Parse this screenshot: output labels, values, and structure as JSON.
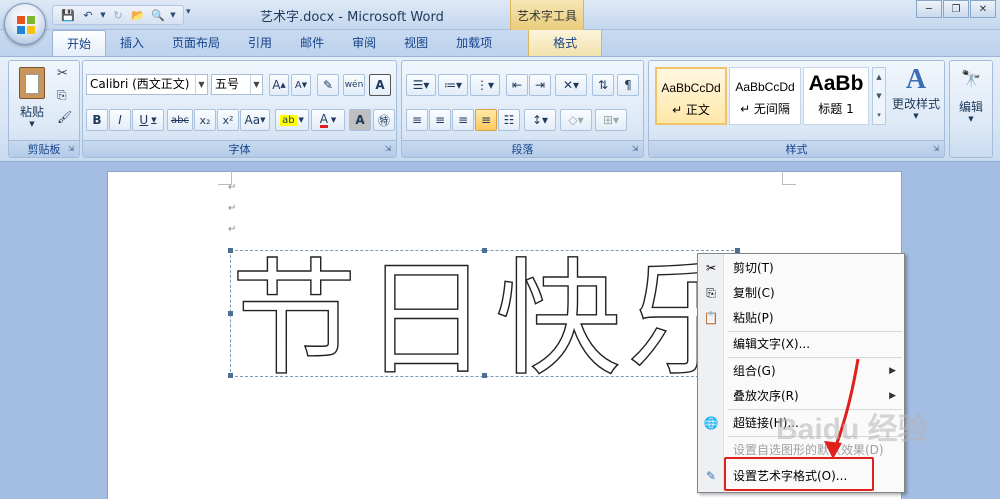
{
  "window": {
    "title": "艺术字.docx - Microsoft Word",
    "context_tool_title": "艺术字工具"
  },
  "tabs": [
    {
      "label": "开始",
      "active": true
    },
    {
      "label": "插入"
    },
    {
      "label": "页面布局"
    },
    {
      "label": "引用"
    },
    {
      "label": "邮件"
    },
    {
      "label": "审阅"
    },
    {
      "label": "视图"
    },
    {
      "label": "加载项"
    },
    {
      "label": "格式",
      "context": true
    }
  ],
  "ribbon": {
    "clipboard": {
      "label": "剪贴板",
      "paste_label": "粘贴"
    },
    "font": {
      "label": "字体",
      "font_name": "Calibri (西文正文)",
      "font_size": "五号",
      "bold": "B",
      "italic": "I",
      "underline": "U",
      "strike": "abc",
      "sub": "x₂",
      "sup": "x²",
      "case": "Aa",
      "wen": "wén",
      "A_glyph": "A"
    },
    "paragraph": {
      "label": "段落"
    },
    "styles": {
      "label": "样式",
      "items": [
        {
          "sample": "AaBbCcDd",
          "name": "↵ 正文"
        },
        {
          "sample": "AaBbCcDd",
          "name": "↵ 无间隔"
        },
        {
          "sample": "AaBb",
          "name": "标题 1"
        }
      ],
      "change_styles": "更改样式"
    },
    "editing": {
      "label": "编辑"
    }
  },
  "document": {
    "para_marks": [
      "↵",
      "↵",
      "↵"
    ],
    "wordart_text": "节日快乐"
  },
  "context_menu": {
    "items": [
      {
        "label": "剪切(T)"
      },
      {
        "label": "复制(C)"
      },
      {
        "label": "粘贴(P)"
      },
      {
        "label": "编辑文字(X)..."
      },
      {
        "label": "组合(G)"
      },
      {
        "label": "叠放次序(R)"
      },
      {
        "label": "超链接(H)..."
      },
      {
        "label": "设置自选图形的默认效果(D)"
      },
      {
        "label": "设置艺术字格式(O)..."
      }
    ]
  },
  "watermark": "Baidu 经验",
  "colors": {
    "highlight": "#e0201a",
    "selected_style": "#f0c36b"
  }
}
